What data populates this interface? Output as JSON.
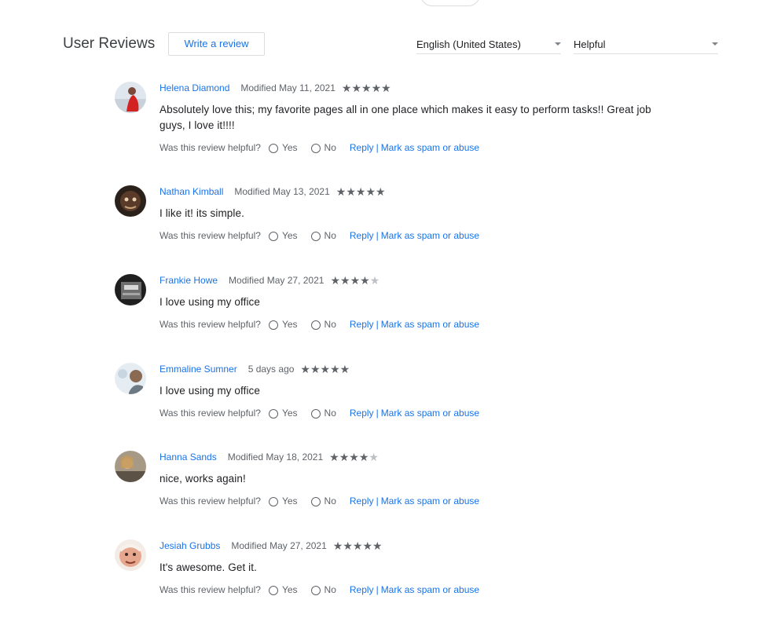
{
  "header": {
    "title": "User Reviews",
    "write_review_label": "Write a review",
    "language": "English (United States)",
    "sort": "Helpful"
  },
  "helpful": {
    "question": "Was this review helpful?",
    "yes": "Yes",
    "no": "No",
    "reply": "Reply",
    "separator": "|",
    "spam": "Mark as spam or abuse"
  },
  "colors": {
    "link": "#1a73e8",
    "star_on": "#5f6368",
    "star_off": "#bdc1c6"
  },
  "reviews": [
    {
      "author": "Helena Diamond",
      "date": "Modified May 11, 2021",
      "rating": 5,
      "text": "Absolutely love this; my favorite pages all in one place which makes it easy to perform tasks!!  Great job guys, I love it!!!!"
    },
    {
      "author": "Nathan Kimball",
      "date": "Modified May 13, 2021",
      "rating": 5,
      "text": "I like it! its simple."
    },
    {
      "author": "Frankie Howe",
      "date": "Modified May 27, 2021",
      "rating": 4,
      "text": "I love using my office"
    },
    {
      "author": "Emmaline Sumner",
      "date": "5 days ago",
      "rating": 5,
      "text": "I love using my office"
    },
    {
      "author": "Hanna Sands",
      "date": "Modified May 18, 2021",
      "rating": 4,
      "text": "nice, works again!"
    },
    {
      "author": "Jesiah Grubbs",
      "date": "Modified May 27, 2021",
      "rating": 5,
      "text": "It's awesome. Get it."
    }
  ]
}
